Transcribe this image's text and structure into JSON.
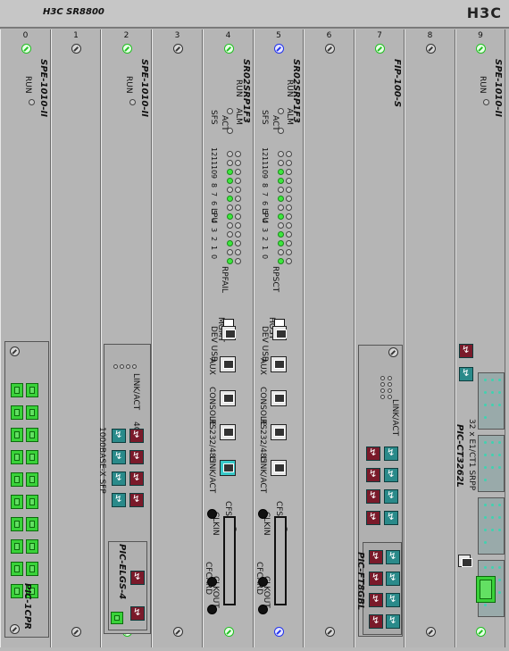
{
  "header": {
    "model": "H3C  SR8800",
    "brand": "H3C"
  },
  "slots": [
    {
      "num": "0",
      "top_screw": "green",
      "bottom_screw": "green",
      "card": "SPE-1010-II",
      "run_label": "RUN"
    },
    {
      "num": "1",
      "top_screw": "gray",
      "bottom_screw": "gray"
    },
    {
      "num": "2",
      "top_screw": "green",
      "bottom_screw": "green",
      "card": "SPE-1010-II",
      "run_label": "RUN"
    },
    {
      "num": "3",
      "top_screw": "gray",
      "bottom_screw": "gray"
    },
    {
      "num": "4",
      "top_screw": "green",
      "bottom_screw": "green",
      "card": "SR02SRP1F3"
    },
    {
      "num": "5",
      "top_screw": "blue",
      "bottom_screw": "blue",
      "card": "SR02SRP1F3"
    },
    {
      "num": "6",
      "top_screw": "gray",
      "bottom_screw": "gray"
    },
    {
      "num": "7",
      "top_screw": "green",
      "bottom_screw": "green",
      "card": "FIP-100-S"
    },
    {
      "num": "8",
      "top_screw": "gray",
      "bottom_screw": "gray"
    },
    {
      "num": "9",
      "top_screw": "green",
      "bottom_screw": "green",
      "card": "SPE-1010-II",
      "run_label": "RUN"
    }
  ],
  "slot0": {
    "pic": "PIC-1CPR",
    "port_count": 10
  },
  "slot2": {
    "pic": "PIC-ELGS-4",
    "link_act": "LINK/ACT",
    "ports_label": "4GE",
    "dup": "1000BASE-X SFP"
  },
  "srp": {
    "run": "RUN",
    "sfs": "SFS",
    "act": "ACT",
    "alm": "ALM",
    "lpu": "LPU",
    "rpfail": "RPFAIL",
    "rpsct": "RPSCT",
    "lpu_numbers": [
      "0",
      "1",
      "2",
      "3",
      "4",
      "5",
      "6",
      "7",
      "8",
      "9",
      "10",
      "11",
      "12"
    ],
    "left_leds_on": [
      0,
      2,
      5,
      7,
      9,
      10
    ],
    "right_leds_on": [
      0,
      2,
      3,
      5,
      7,
      9,
      10
    ],
    "mgmt": "MGMT",
    "host": "HOST",
    "dev_usb": "DEV USB",
    "aux": "AUX",
    "console": "CONSOLE",
    "rs232": "RS232/485",
    "link_act": "LINK/ACT",
    "cfs": "CFS",
    "cfcard": "CFCARD",
    "clkin": "CLKIN",
    "clkout": "CLKOUT"
  },
  "slot7": {
    "pic": "PIC-FT8GBL",
    "link_act": "LINK/ACT"
  },
  "slot9": {
    "pic": "PIC-CT3262L",
    "ports_label": "32 x E1/CT1 SRPP"
  },
  "icons": {
    "screw": "screw-icon",
    "fiber": "fiber-port-icon",
    "rj45": "rj45-port-icon"
  },
  "colors": {
    "led_on": "#3ee83e",
    "fiber": "#2a8a8a",
    "screw_active": "#22c022",
    "screw_selected": "#2233ee"
  }
}
